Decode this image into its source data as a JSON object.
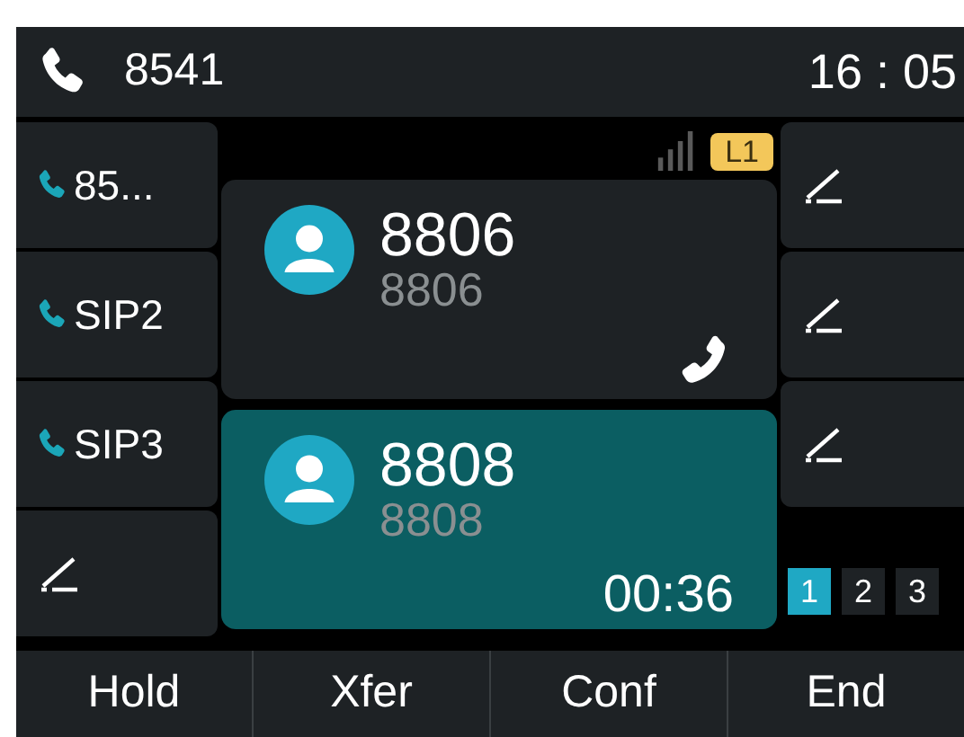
{
  "status_bar": {
    "account": "8541",
    "time": "16 : 05",
    "line_badge": "L1"
  },
  "left_keys": [
    {
      "kind": "line",
      "label": "85..."
    },
    {
      "kind": "line",
      "label": "SIP2"
    },
    {
      "kind": "line",
      "label": "SIP3"
    },
    {
      "kind": "empty"
    }
  ],
  "calls": [
    {
      "name": "8806",
      "number": "8806",
      "selected": false,
      "kind": "phone"
    },
    {
      "name": "8808",
      "number": "8808",
      "selected": true,
      "kind": "timer",
      "duration": "00:36"
    }
  ],
  "right_keys": [
    {
      "kind": "empty"
    },
    {
      "kind": "empty"
    },
    {
      "kind": "empty"
    }
  ],
  "pages": [
    {
      "label": "1",
      "selected": true
    },
    {
      "label": "2",
      "selected": false
    },
    {
      "label": "3",
      "selected": false
    }
  ],
  "softkeys": [
    "Hold",
    "Xfer",
    "Conf",
    "End"
  ]
}
